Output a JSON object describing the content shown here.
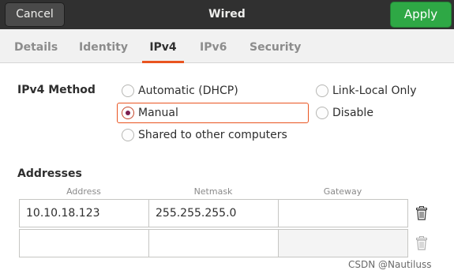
{
  "header": {
    "cancel_label": "Cancel",
    "title": "Wired",
    "apply_label": "Apply"
  },
  "tabs": [
    {
      "label": "Details",
      "active": false
    },
    {
      "label": "Identity",
      "active": false
    },
    {
      "label": "IPv4",
      "active": true
    },
    {
      "label": "IPv6",
      "active": false
    },
    {
      "label": "Security",
      "active": false
    }
  ],
  "ipv4_method": {
    "label": "IPv4 Method",
    "options": [
      {
        "label": "Automatic (DHCP)",
        "checked": false
      },
      {
        "label": "Manual",
        "checked": true
      },
      {
        "label": "Shared to other computers",
        "checked": false
      },
      {
        "label": "Link-Local Only",
        "checked": false
      },
      {
        "label": "Disable",
        "checked": false
      }
    ]
  },
  "addresses": {
    "label": "Addresses",
    "columns": [
      "Address",
      "Netmask",
      "Gateway"
    ],
    "rows": [
      {
        "address": "10.10.18.123",
        "netmask": "255.255.255.0",
        "gateway": ""
      },
      {
        "address": "",
        "netmask": "",
        "gateway": ""
      }
    ]
  },
  "watermark": "CSDN @Nautiluss",
  "colors": {
    "accent": "#e95420",
    "apply_green": "#2ea845",
    "headerbar": "#303030",
    "radio_dot": "#7a1e50"
  }
}
